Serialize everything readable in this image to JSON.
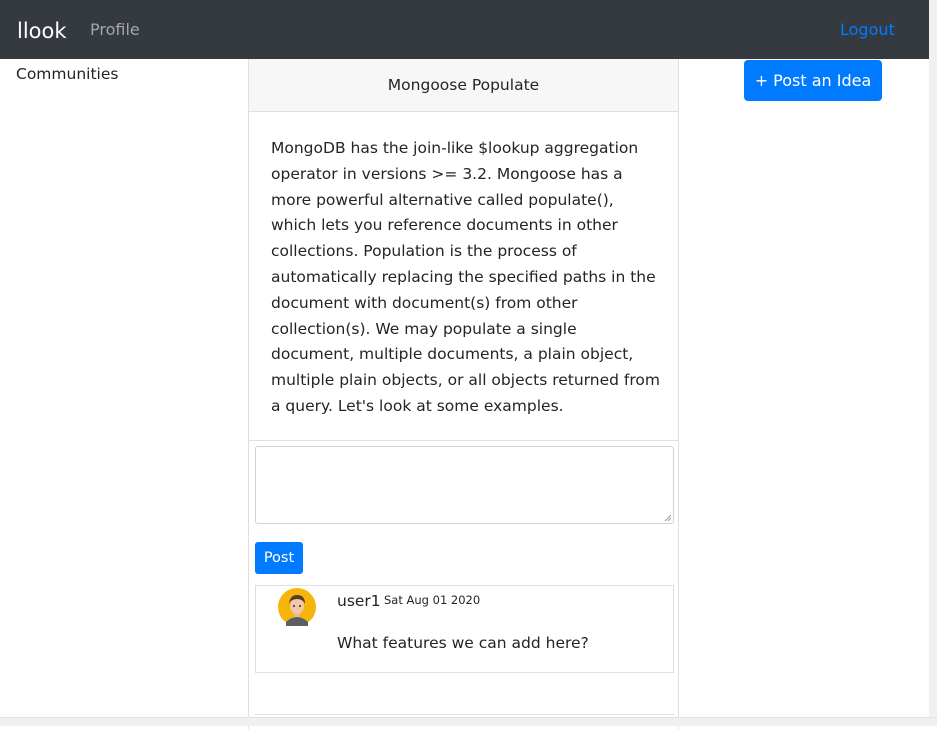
{
  "navbar": {
    "brand": "llook",
    "profile_label": "Profile",
    "logout_label": "Logout"
  },
  "sidebar": {
    "communities_label": "Communities"
  },
  "post": {
    "title": "Mongoose Populate",
    "body": "MongoDB has the join-like $lookup aggregation operator in versions >= 3.2. Mongoose has a more powerful alternative called populate(), which lets you reference documents in other collections. Population is the process of automatically replacing the specified paths in the document with document(s) from other collection(s). We may populate a single document, multiple documents, a plain object, multiple plain objects, or all objects returned from a query. Let's look at some examples."
  },
  "comment_form": {
    "value": "",
    "post_label": "Post"
  },
  "comments": [
    {
      "user": "user1",
      "date": "Sat Aug 01 2020",
      "text": "What features we can add here?",
      "avatar_icon": "user-avatar-icon"
    }
  ],
  "actions": {
    "post_idea_label": "+ Post an Idea"
  },
  "colors": {
    "navbar": "#343a40",
    "primary": "#007bff",
    "header_bg": "#f7f7f7"
  }
}
